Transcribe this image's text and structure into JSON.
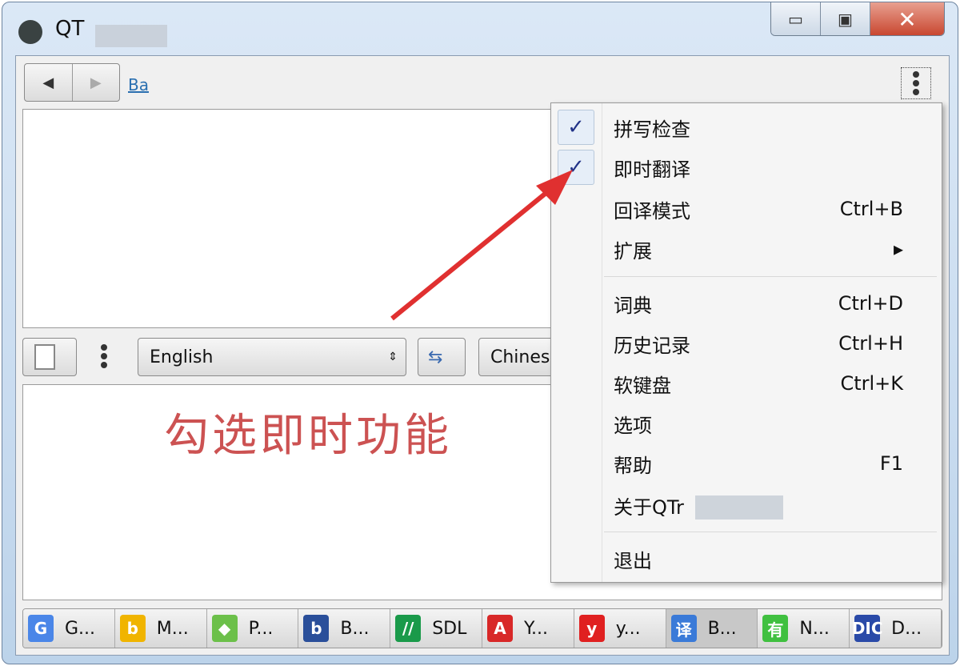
{
  "window": {
    "title": "QT",
    "controls": {
      "minimize": "▭",
      "maximize": "▣",
      "close": "✕"
    }
  },
  "toolbar": {
    "back": "◀",
    "forward": "▶",
    "link": "Ba"
  },
  "lang": {
    "source": "English",
    "target": "Chines",
    "swap": "⇆"
  },
  "annotation": "勾选即时功能",
  "menu": {
    "items": [
      {
        "label": "拼写检查",
        "shortcut": "",
        "checked": true
      },
      {
        "label": "即时翻译",
        "shortcut": "",
        "checked": true
      },
      {
        "label": "回译模式",
        "shortcut": "Ctrl+B",
        "checked": false
      },
      {
        "label": "扩展",
        "shortcut": "▸",
        "checked": false
      },
      {
        "label": "词典",
        "shortcut": "Ctrl+D"
      },
      {
        "label": "历史记录",
        "shortcut": "Ctrl+H"
      },
      {
        "label": "软键盘",
        "shortcut": "Ctrl+K"
      },
      {
        "label": "选项",
        "shortcut": ""
      },
      {
        "label": "帮助",
        "shortcut": "F1"
      },
      {
        "label": "关于QTr",
        "shortcut": ""
      },
      {
        "label": "退出",
        "shortcut": ""
      }
    ]
  },
  "tabs": [
    {
      "label": "G...",
      "icon": "G",
      "color": "#4a86e8"
    },
    {
      "label": "M...",
      "icon": "b",
      "color": "#f0b400"
    },
    {
      "label": "P...",
      "icon": "◆",
      "color": "#6cc04a"
    },
    {
      "label": "B...",
      "icon": "b",
      "color": "#2a4f9a"
    },
    {
      "label": "SDL",
      "icon": "//",
      "color": "#1a9a4a"
    },
    {
      "label": "Y...",
      "icon": "A",
      "color": "#d82828"
    },
    {
      "label": "y...",
      "icon": "y",
      "color": "#e02020"
    },
    {
      "label": "B...",
      "icon": "译",
      "color": "#3a7ad8"
    },
    {
      "label": "N...",
      "icon": "有",
      "color": "#40c040"
    },
    {
      "label": "D...",
      "icon": "DIC",
      "color": "#2a4aa8"
    }
  ]
}
